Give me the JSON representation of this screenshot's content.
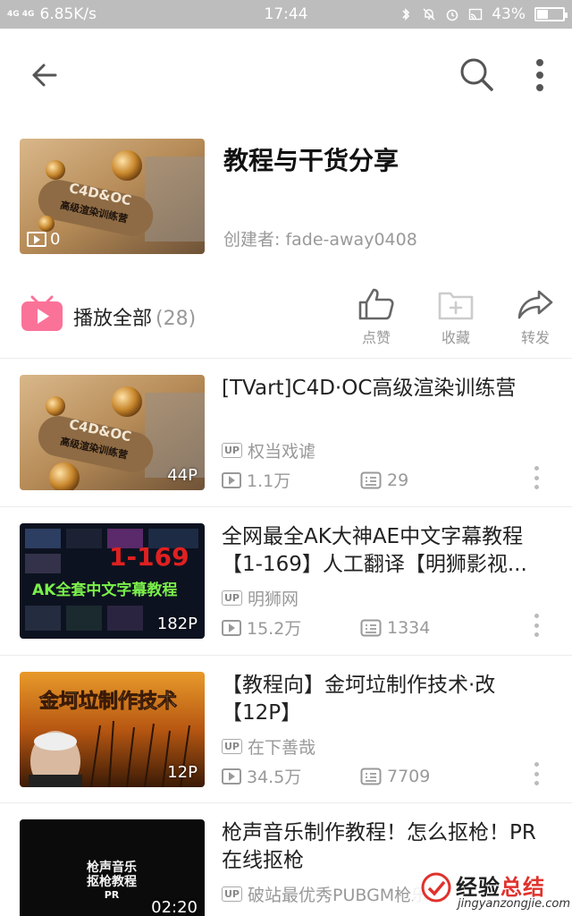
{
  "status_bar": {
    "network": "4G 4G",
    "speed": "6.85K/s",
    "time": "17:44",
    "battery": "43%",
    "battery_level": 0.43
  },
  "playlist": {
    "title": "教程与干货分享",
    "creator": "创建者: fade-away0408",
    "cover_count": "0",
    "cover_text": "C4D&OC",
    "cover_subtext": "高级渲染训练营"
  },
  "actions": {
    "play_all": "播放全部",
    "play_all_count": "(28)",
    "like": "点赞",
    "favorite": "收藏",
    "share": "转发"
  },
  "videos": [
    {
      "title": "[TVart]C4D·OC高级渲染训练营",
      "up": "权当戏谑",
      "views": "1.1万",
      "danmaku": "29",
      "badge": "44P",
      "thumb_text": "C4D&OC",
      "thumb_subtext": "高级渲染训练营"
    },
    {
      "title": "全网最全AK大神AE中文字幕教程【1-169】人工翻译【明狮影视...",
      "up": "明狮网",
      "views": "15.2万",
      "danmaku": "1334",
      "badge": "182P",
      "thumb_text": "1-169",
      "thumb_subtext": "AK全套中文字幕教程"
    },
    {
      "title": "【教程向】金坷垃制作技术·改【12P】",
      "up": "在下善哉",
      "views": "34.5万",
      "danmaku": "7709",
      "badge": "12P",
      "thumb_text": "金坷垃制作技术"
    },
    {
      "title": "枪声音乐制作教程！怎么抠枪！PR在线抠枪",
      "up": "破站最优秀PUBGM枪乐",
      "badge": "02:20",
      "thumb_text": "枪声音乐",
      "thumb_subtext": "抠枪教程",
      "thumb_subtext2": "PR"
    }
  ],
  "up_label": "UP",
  "watermark": {
    "main_a": "经验",
    "main_b": "总结",
    "url": "jingyanzongjie.com"
  },
  "colors": {
    "accent_pink": "#fb7299",
    "text_gray": "#999999"
  }
}
